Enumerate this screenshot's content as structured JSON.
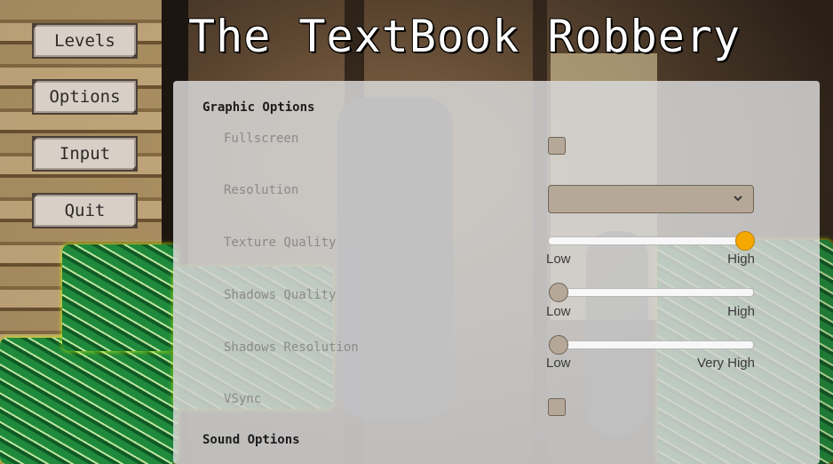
{
  "game_title": "The TextBook Robbery",
  "menu": {
    "levels_label": "Levels",
    "options_label": "Options",
    "input_label": "Input",
    "quit_label": "Quit"
  },
  "graphic_options": {
    "section_title": "Graphic Options",
    "fullscreen": {
      "label": "Fullscreen",
      "checked": false
    },
    "resolution": {
      "label": "Resolution",
      "value": ""
    },
    "texture_quality": {
      "label": "Texture Quality",
      "min_label": "Low",
      "max_label": "High",
      "value": 1.0
    },
    "shadows_quality": {
      "label": "Shadows Quality",
      "min_label": "Low",
      "max_label": "High",
      "value": 0.0
    },
    "shadows_resolution": {
      "label": "Shadows Resolution",
      "min_label": "Low",
      "max_label": "Very High",
      "value": 0.0
    },
    "vsync": {
      "label": "VSync",
      "checked": false
    }
  },
  "sound_options": {
    "section_title": "Sound Options"
  },
  "colors": {
    "slider_thumb_active": "#f5a800",
    "control_fill": "#b6a898",
    "panel_background": "#d7d7d7"
  }
}
